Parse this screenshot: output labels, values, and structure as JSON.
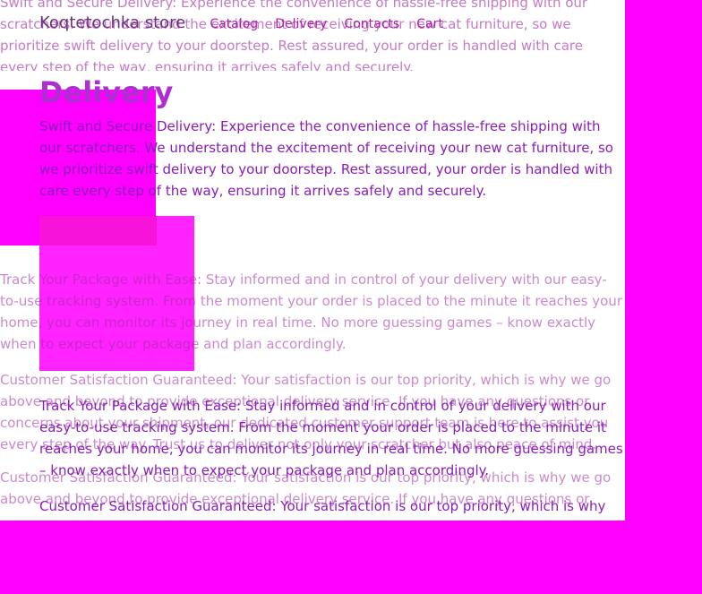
{
  "brand": {
    "title": "Koqtetochka store"
  },
  "nav": {
    "items": [
      {
        "label": "Catalog"
      },
      {
        "label": "Delivery"
      },
      {
        "label": "Contacts"
      },
      {
        "label": "Cart"
      }
    ]
  },
  "page": {
    "heading": "Delivery",
    "sections": [
      {
        "text": "Swift and Secure Delivery: Experience the convenience of hassle-free shipping with our scratchers. We understand the excitement of receiving your new cat furniture, so we prioritize swift delivery to your doorstep. Rest assured, your order is handled with care every step of the way, ensuring it arrives safely and securely."
      },
      {
        "text": "Track Your Package with Ease: Stay informed and in control of your delivery with our easy-to-use tracking system. From the moment your order is placed to the minute it reaches your home, you can monitor its journey in real time. No more guessing games – know exactly when to expect your package and plan accordingly."
      },
      {
        "text": "Customer Satisfaction Guaranteed: Your satisfaction is our top priority, which is why we go above and beyond to provide exceptional delivery service. If you have any questions or concerns about your shipment, our dedicated customer support team is here to assist you every step of the way. Trust us to deliver not only your scratcher but also peace of mind."
      }
    ]
  },
  "colors": {
    "background": "#ff00ff",
    "panel": "#ffffff",
    "accent": "#cf8a00"
  }
}
